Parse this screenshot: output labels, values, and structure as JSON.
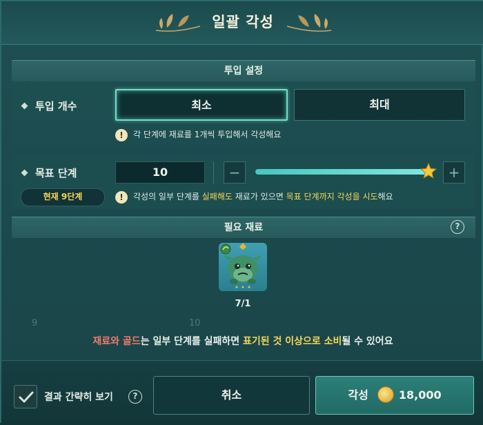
{
  "dialog": {
    "title": "일괄 각성"
  },
  "input_setting": {
    "header": "투입 설정",
    "count_label": "투입 개수",
    "min_label": "최소",
    "max_label": "최대",
    "note": "각 단계에 재료를 1개씩 투입해서 각성해요"
  },
  "target_stage": {
    "label": "목표 단계",
    "value": "10",
    "current_stage": "현재 9단계",
    "slider_value_fraction": 1.0,
    "note_part1": "각성의 일부 단계를 ",
    "note_fail": "실패해도",
    "note_part2": " 재료가 있으면 ",
    "note_target": "목표 단계까지",
    "note_part3": " ",
    "note_try": "각성을 시도",
    "note_part4": "해요"
  },
  "required_materials": {
    "header": "필요 재료",
    "help": "?",
    "items": [
      {
        "count": "7/1",
        "stars": 3
      }
    ]
  },
  "warning": {
    "part1": "재료와 골드",
    "part2": "는 일부 단계를 실패하면 ",
    "part3": "표기된 것 이상으로 소비",
    "part4": "될 수 있어요"
  },
  "footer": {
    "simple_view_label": "결과 간략히 보기",
    "help": "?",
    "cancel_label": "취소",
    "awaken_label": "각성",
    "gold_cost": "18,000"
  },
  "colors": {
    "accent_teal": "#6fe0c8",
    "highlight_yellow": "#f5d75a",
    "warning_red": "#f07b6b"
  }
}
